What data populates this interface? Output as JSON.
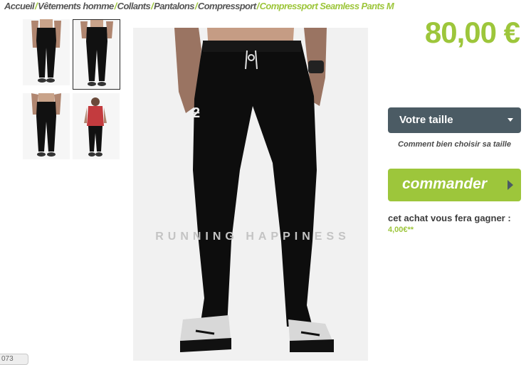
{
  "breadcrumb": {
    "items": [
      "Accueil",
      "Vêtements homme",
      "Collants",
      "Pantalons",
      "Compressport"
    ],
    "current": "Compressport Seamless Pants M",
    "separator": "/"
  },
  "gallery": {
    "thumbnails": [
      {
        "name": "thumb-front-hands-pockets",
        "icon": "model-pants-front"
      },
      {
        "name": "thumb-front",
        "icon": "model-pants-front",
        "selected": true
      },
      {
        "name": "thumb-back",
        "icon": "model-pants-back"
      },
      {
        "name": "thumb-side-red-shirt",
        "icon": "model-red-shirt"
      }
    ],
    "watermark": "RUNNING HAPPINESS"
  },
  "product": {
    "price": "80,00 €",
    "size_select_label": "Votre taille",
    "size_guide_link": "Comment bien choisir sa taille",
    "order_button": "commander",
    "reward_text": "cet achat vous fera gagner :",
    "reward_amount": "4,00€**"
  },
  "status_tab": "073",
  "colors": {
    "accent": "#9dc63b",
    "select_bg": "#4b5b64",
    "breadcrumb_text": "#555555"
  }
}
